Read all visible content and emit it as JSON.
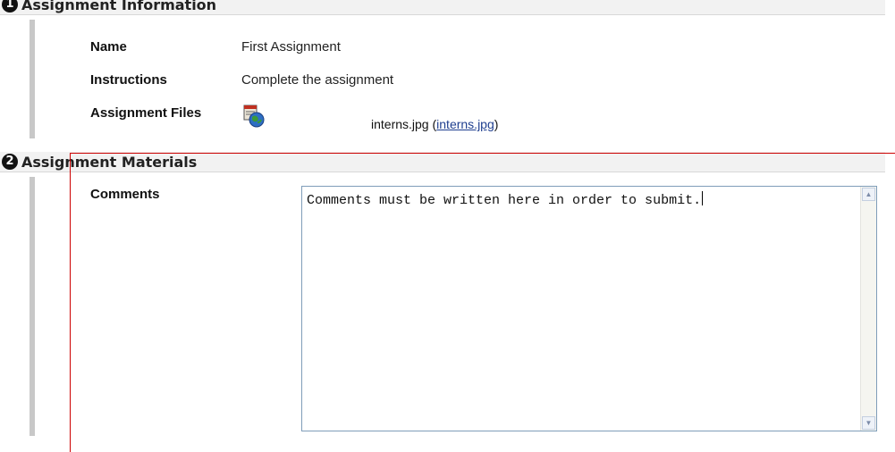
{
  "sections": [
    {
      "number": "1",
      "title": "Assignment Information"
    },
    {
      "number": "2",
      "title": "Assignment Materials"
    }
  ],
  "assignment_info": {
    "name_label": "Name",
    "name_value": "First Assignment",
    "instructions_label": "Instructions",
    "instructions_value": "Complete the assignment",
    "files_label": "Assignment Files",
    "file_name": "interns.jpg",
    "file_open_paren": "(",
    "file_link": "interns.jpg",
    "file_close_paren": ")",
    "file_icon": "file-globe-icon"
  },
  "assignment_materials": {
    "comments_label": "Comments",
    "comments_value": "Comments must be written here in order to submit."
  },
  "colors": {
    "link": "#1f3f8f",
    "annotation_line": "#cc0000"
  }
}
